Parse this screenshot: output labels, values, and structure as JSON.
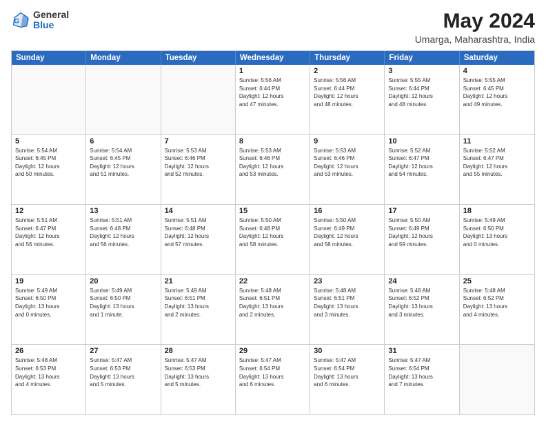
{
  "logo": {
    "general": "General",
    "blue": "Blue"
  },
  "title": "May 2024",
  "subtitle": "Umarga, Maharashtra, India",
  "days": [
    "Sunday",
    "Monday",
    "Tuesday",
    "Wednesday",
    "Thursday",
    "Friday",
    "Saturday"
  ],
  "weeks": [
    [
      {
        "day": "",
        "info": ""
      },
      {
        "day": "",
        "info": ""
      },
      {
        "day": "",
        "info": ""
      },
      {
        "day": "1",
        "info": "Sunrise: 5:56 AM\nSunset: 6:44 PM\nDaylight: 12 hours\nand 47 minutes."
      },
      {
        "day": "2",
        "info": "Sunrise: 5:56 AM\nSunset: 6:44 PM\nDaylight: 12 hours\nand 48 minutes."
      },
      {
        "day": "3",
        "info": "Sunrise: 5:55 AM\nSunset: 6:44 PM\nDaylight: 12 hours\nand 48 minutes."
      },
      {
        "day": "4",
        "info": "Sunrise: 5:55 AM\nSunset: 6:45 PM\nDaylight: 12 hours\nand 49 minutes."
      }
    ],
    [
      {
        "day": "5",
        "info": "Sunrise: 5:54 AM\nSunset: 6:45 PM\nDaylight: 12 hours\nand 50 minutes."
      },
      {
        "day": "6",
        "info": "Sunrise: 5:54 AM\nSunset: 6:45 PM\nDaylight: 12 hours\nand 51 minutes."
      },
      {
        "day": "7",
        "info": "Sunrise: 5:53 AM\nSunset: 6:46 PM\nDaylight: 12 hours\nand 52 minutes."
      },
      {
        "day": "8",
        "info": "Sunrise: 5:53 AM\nSunset: 6:46 PM\nDaylight: 12 hours\nand 53 minutes."
      },
      {
        "day": "9",
        "info": "Sunrise: 5:53 AM\nSunset: 6:46 PM\nDaylight: 12 hours\nand 53 minutes."
      },
      {
        "day": "10",
        "info": "Sunrise: 5:52 AM\nSunset: 6:47 PM\nDaylight: 12 hours\nand 54 minutes."
      },
      {
        "day": "11",
        "info": "Sunrise: 5:52 AM\nSunset: 6:47 PM\nDaylight: 12 hours\nand 55 minutes."
      }
    ],
    [
      {
        "day": "12",
        "info": "Sunrise: 5:51 AM\nSunset: 6:47 PM\nDaylight: 12 hours\nand 56 minutes."
      },
      {
        "day": "13",
        "info": "Sunrise: 5:51 AM\nSunset: 6:48 PM\nDaylight: 12 hours\nand 56 minutes."
      },
      {
        "day": "14",
        "info": "Sunrise: 5:51 AM\nSunset: 6:48 PM\nDaylight: 12 hours\nand 57 minutes."
      },
      {
        "day": "15",
        "info": "Sunrise: 5:50 AM\nSunset: 6:48 PM\nDaylight: 12 hours\nand 58 minutes."
      },
      {
        "day": "16",
        "info": "Sunrise: 5:50 AM\nSunset: 6:49 PM\nDaylight: 12 hours\nand 58 minutes."
      },
      {
        "day": "17",
        "info": "Sunrise: 5:50 AM\nSunset: 6:49 PM\nDaylight: 12 hours\nand 59 minutes."
      },
      {
        "day": "18",
        "info": "Sunrise: 5:49 AM\nSunset: 6:50 PM\nDaylight: 13 hours\nand 0 minutes."
      }
    ],
    [
      {
        "day": "19",
        "info": "Sunrise: 5:49 AM\nSunset: 6:50 PM\nDaylight: 13 hours\nand 0 minutes."
      },
      {
        "day": "20",
        "info": "Sunrise: 5:49 AM\nSunset: 6:50 PM\nDaylight: 13 hours\nand 1 minute."
      },
      {
        "day": "21",
        "info": "Sunrise: 5:49 AM\nSunset: 6:51 PM\nDaylight: 13 hours\nand 2 minutes."
      },
      {
        "day": "22",
        "info": "Sunrise: 5:48 AM\nSunset: 6:51 PM\nDaylight: 13 hours\nand 2 minutes."
      },
      {
        "day": "23",
        "info": "Sunrise: 5:48 AM\nSunset: 6:51 PM\nDaylight: 13 hours\nand 3 minutes."
      },
      {
        "day": "24",
        "info": "Sunrise: 5:48 AM\nSunset: 6:52 PM\nDaylight: 13 hours\nand 3 minutes."
      },
      {
        "day": "25",
        "info": "Sunrise: 5:48 AM\nSunset: 6:52 PM\nDaylight: 13 hours\nand 4 minutes."
      }
    ],
    [
      {
        "day": "26",
        "info": "Sunrise: 5:48 AM\nSunset: 6:53 PM\nDaylight: 13 hours\nand 4 minutes."
      },
      {
        "day": "27",
        "info": "Sunrise: 5:47 AM\nSunset: 6:53 PM\nDaylight: 13 hours\nand 5 minutes."
      },
      {
        "day": "28",
        "info": "Sunrise: 5:47 AM\nSunset: 6:53 PM\nDaylight: 13 hours\nand 5 minutes."
      },
      {
        "day": "29",
        "info": "Sunrise: 5:47 AM\nSunset: 6:54 PM\nDaylight: 13 hours\nand 6 minutes."
      },
      {
        "day": "30",
        "info": "Sunrise: 5:47 AM\nSunset: 6:54 PM\nDaylight: 13 hours\nand 6 minutes."
      },
      {
        "day": "31",
        "info": "Sunrise: 5:47 AM\nSunset: 6:54 PM\nDaylight: 13 hours\nand 7 minutes."
      },
      {
        "day": "",
        "info": ""
      }
    ]
  ]
}
